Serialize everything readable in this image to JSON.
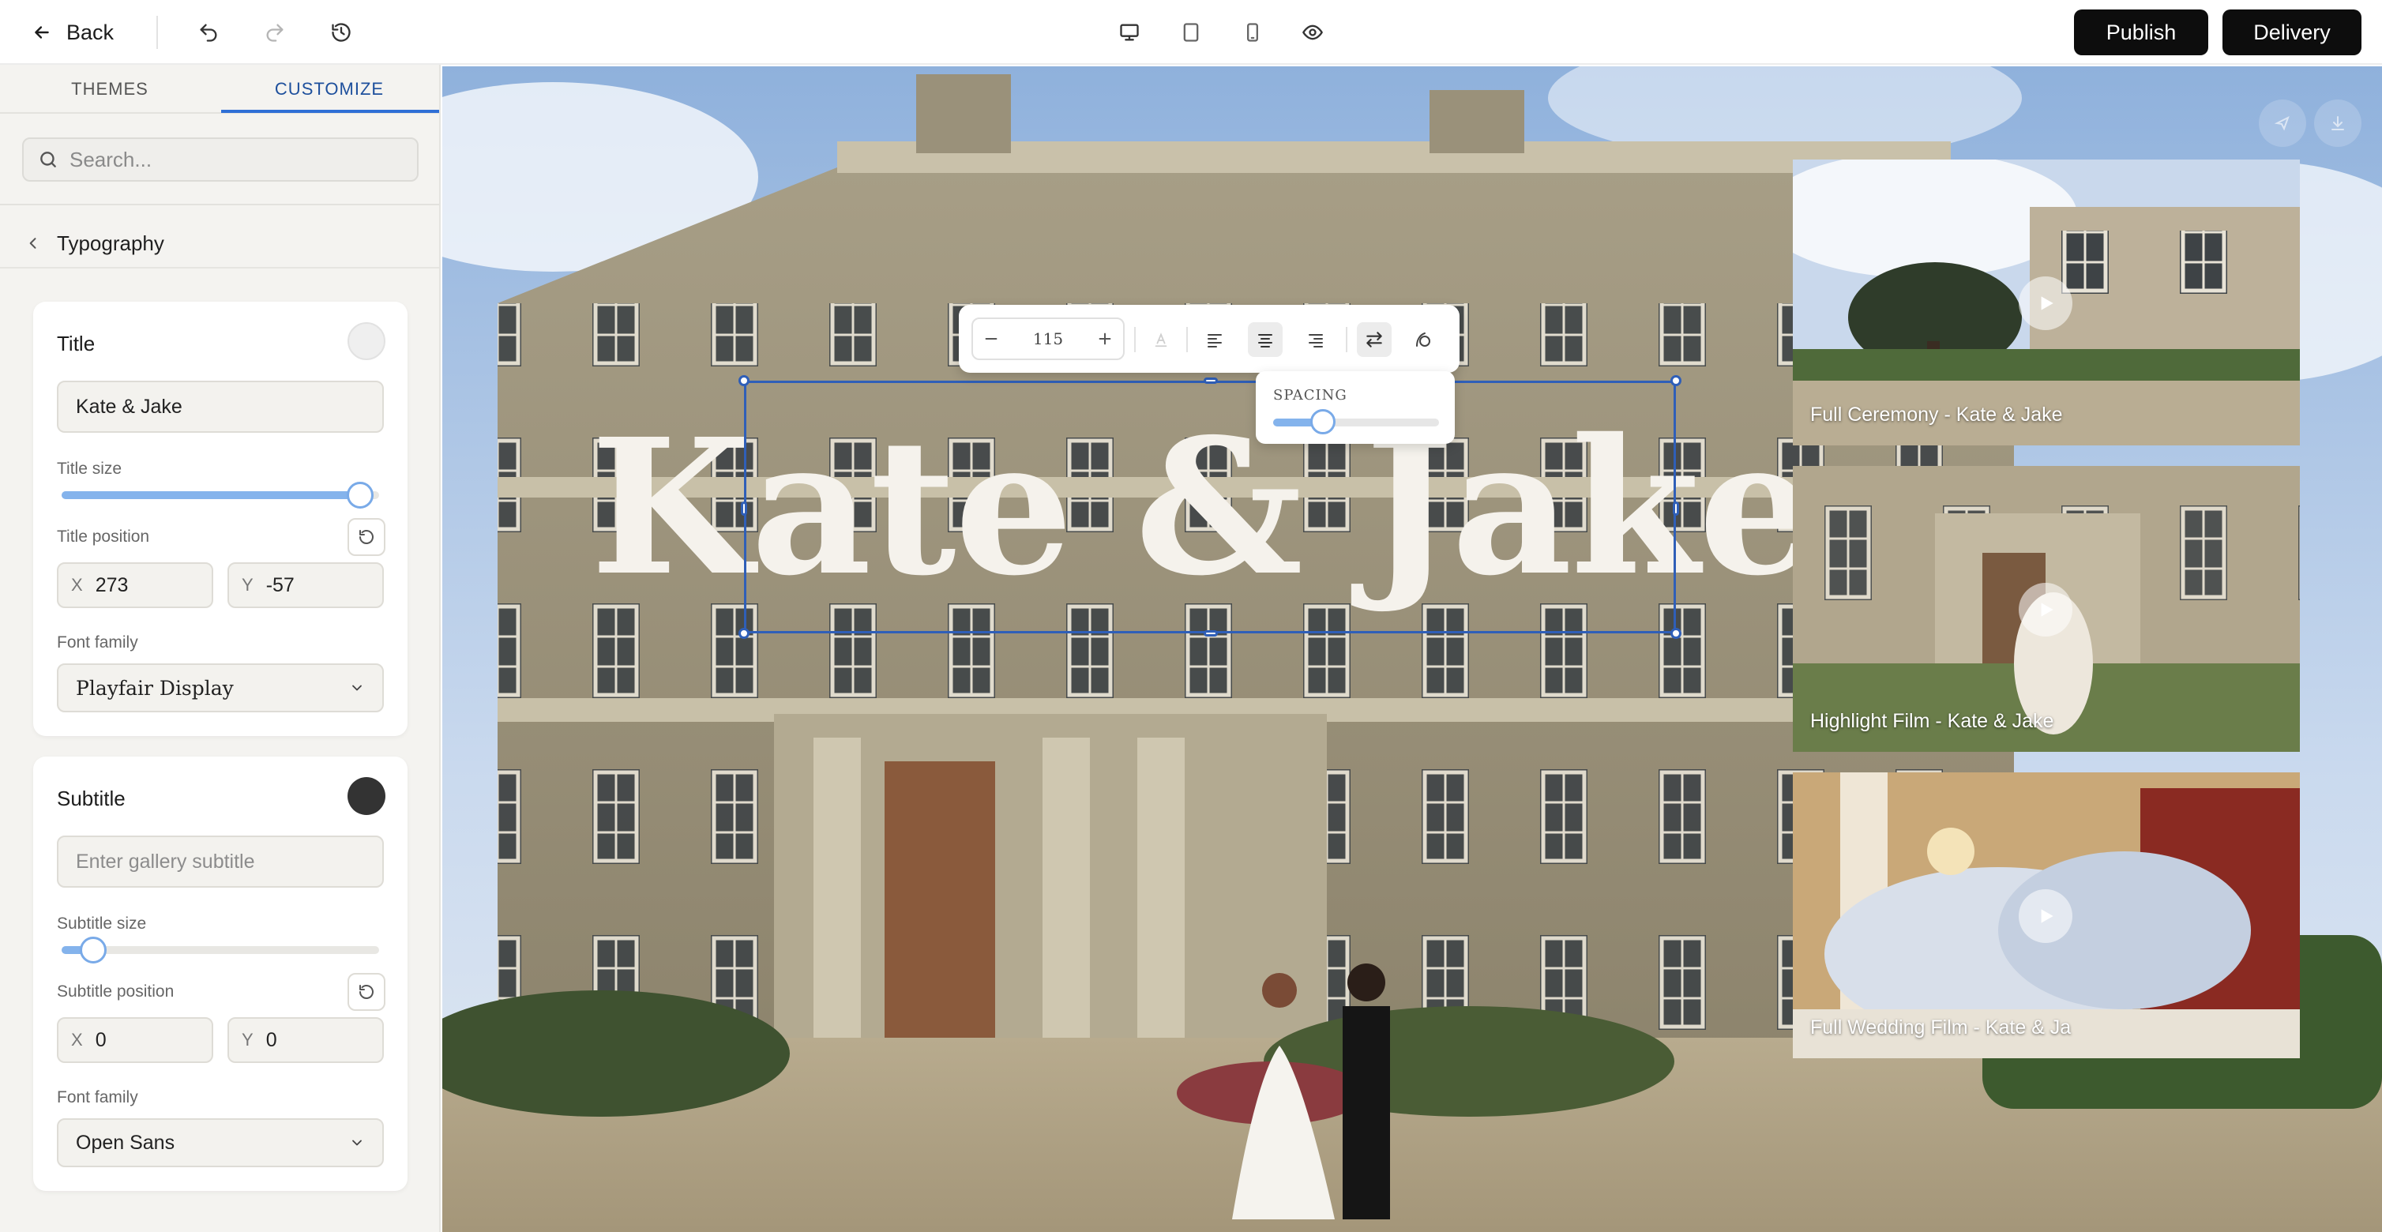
{
  "topbar": {
    "back_label": "Back",
    "publish_label": "Publish",
    "delivery_label": "Delivery"
  },
  "sidebar": {
    "tabs": [
      {
        "label": "THEMES",
        "active": false
      },
      {
        "label": "CUSTOMIZE",
        "active": true
      }
    ],
    "search": {
      "placeholder": "Search..."
    },
    "breadcrumb": "Typography",
    "title_card": {
      "heading": "Title",
      "swatch_color": "#f0f0f0",
      "value": "Kate & Jake",
      "size_label": "Title size",
      "size_fraction": 0.94,
      "position_label": "Title position",
      "x_axis": "X",
      "x": "273",
      "y_axis": "Y",
      "y": "-57",
      "font_label": "Font family",
      "font": "Playfair Display"
    },
    "subtitle_card": {
      "heading": "Subtitle",
      "swatch_color": "#333333",
      "placeholder": "Enter gallery subtitle",
      "size_label": "Subtitle size",
      "size_fraction": 0.1,
      "position_label": "Subtitle position",
      "x_axis": "X",
      "x": "0",
      "y_axis": "Y",
      "y": "0",
      "font_label": "Font family",
      "font": "Open Sans"
    }
  },
  "canvas": {
    "hero_title": "Kate & Jake",
    "toolbar": {
      "font_size": "115"
    },
    "spacing": {
      "label": "SPACING",
      "fraction": 0.3
    },
    "videos": [
      {
        "caption": "Full Ceremony - Kate & Jake"
      },
      {
        "caption": "Highlight Film - Kate & Jake"
      },
      {
        "caption": "Full Wedding Film - Kate & Ja"
      }
    ]
  },
  "colors": {
    "accent": "#2f6fd6",
    "selection": "#2f5fb8",
    "button_dark": "#0d0d0d"
  }
}
